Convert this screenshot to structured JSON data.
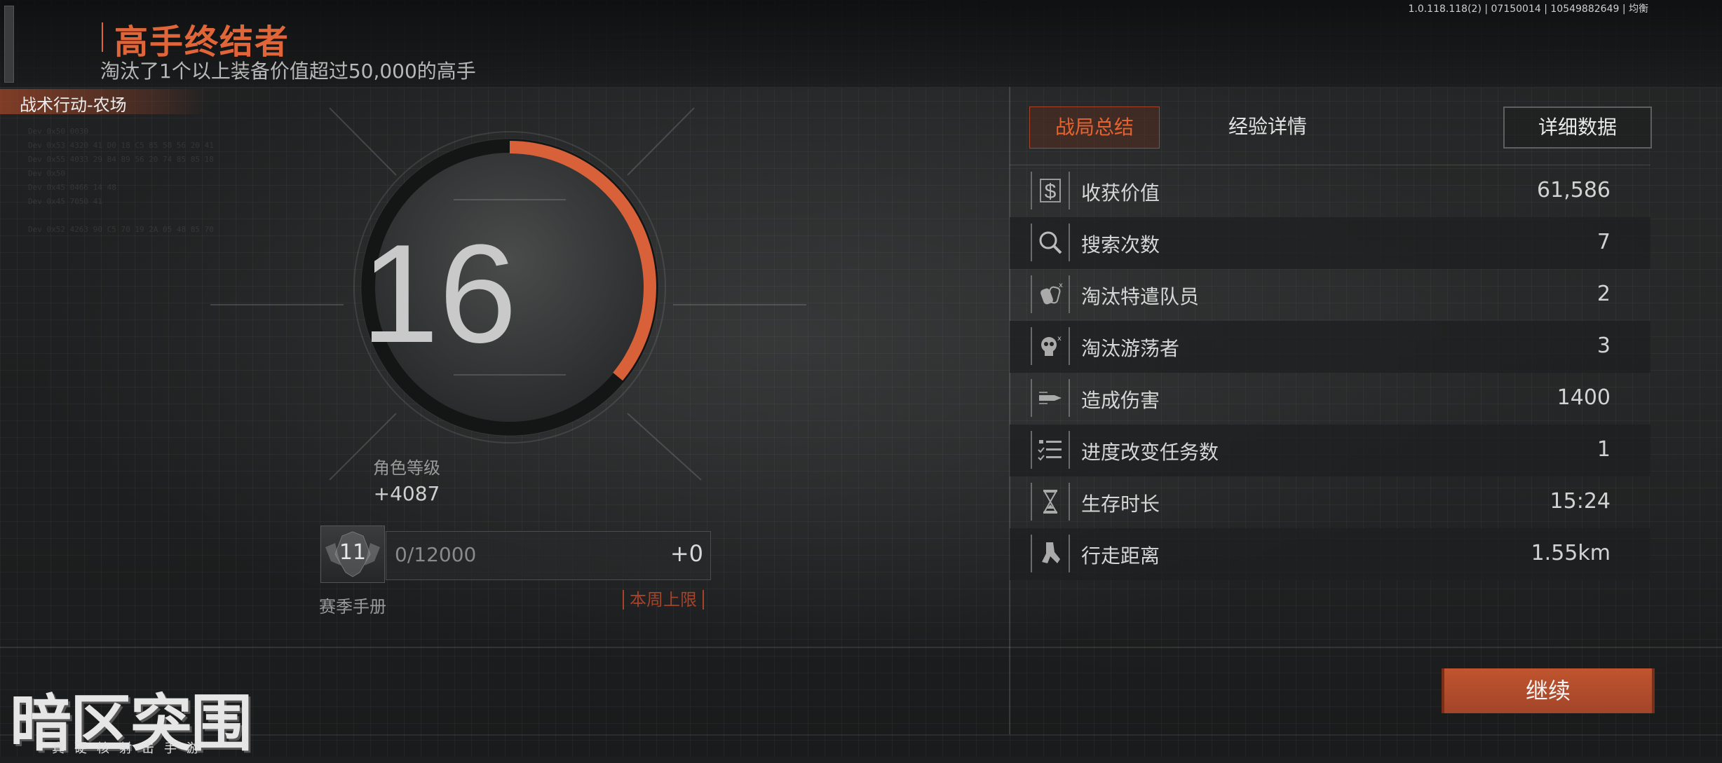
{
  "header": {
    "title": "高手终结者",
    "subtitle": "淘汰了1个以上装备价值超过50,000的高手",
    "version": "1.0.118.118(2) | 07150014 | 10549882649 | 均衡"
  },
  "map_tag": "战术行动-农场",
  "level": {
    "value": "16",
    "label": "角色等级",
    "exp_gain": "+4087",
    "progress_fraction": 0.36
  },
  "season": {
    "badge_level": "11",
    "progress_text": "0/12000",
    "gain": "+0",
    "label": "赛季手册",
    "week_limit": "本周上限"
  },
  "tabs": {
    "summary": "战局总结",
    "exp_details": "经验详情",
    "detail_button": "详细数据"
  },
  "stats": [
    {
      "icon": "dollar-icon",
      "label": "收获价值",
      "value": "61,586"
    },
    {
      "icon": "search-icon",
      "label": "搜索次数",
      "value": "7"
    },
    {
      "icon": "dogtag-icon",
      "label": "淘汰特遣队员",
      "value": "2"
    },
    {
      "icon": "skull-icon",
      "label": "淘汰游荡者",
      "value": "3"
    },
    {
      "icon": "bullet-icon",
      "label": "造成伤害",
      "value": "1400"
    },
    {
      "icon": "checklist-icon",
      "label": "进度改变任务数",
      "value": "1"
    },
    {
      "icon": "hourglass-icon",
      "label": "生存时长",
      "value": "15:24"
    },
    {
      "icon": "walking-icon",
      "label": "行走距离",
      "value": "1.55km"
    }
  ],
  "continue_button": "继续",
  "logo": {
    "main": "暗区突围",
    "sub": "真硬核射击手游"
  },
  "colors": {
    "accent": "#e0663a",
    "button": "#b04a2c"
  }
}
